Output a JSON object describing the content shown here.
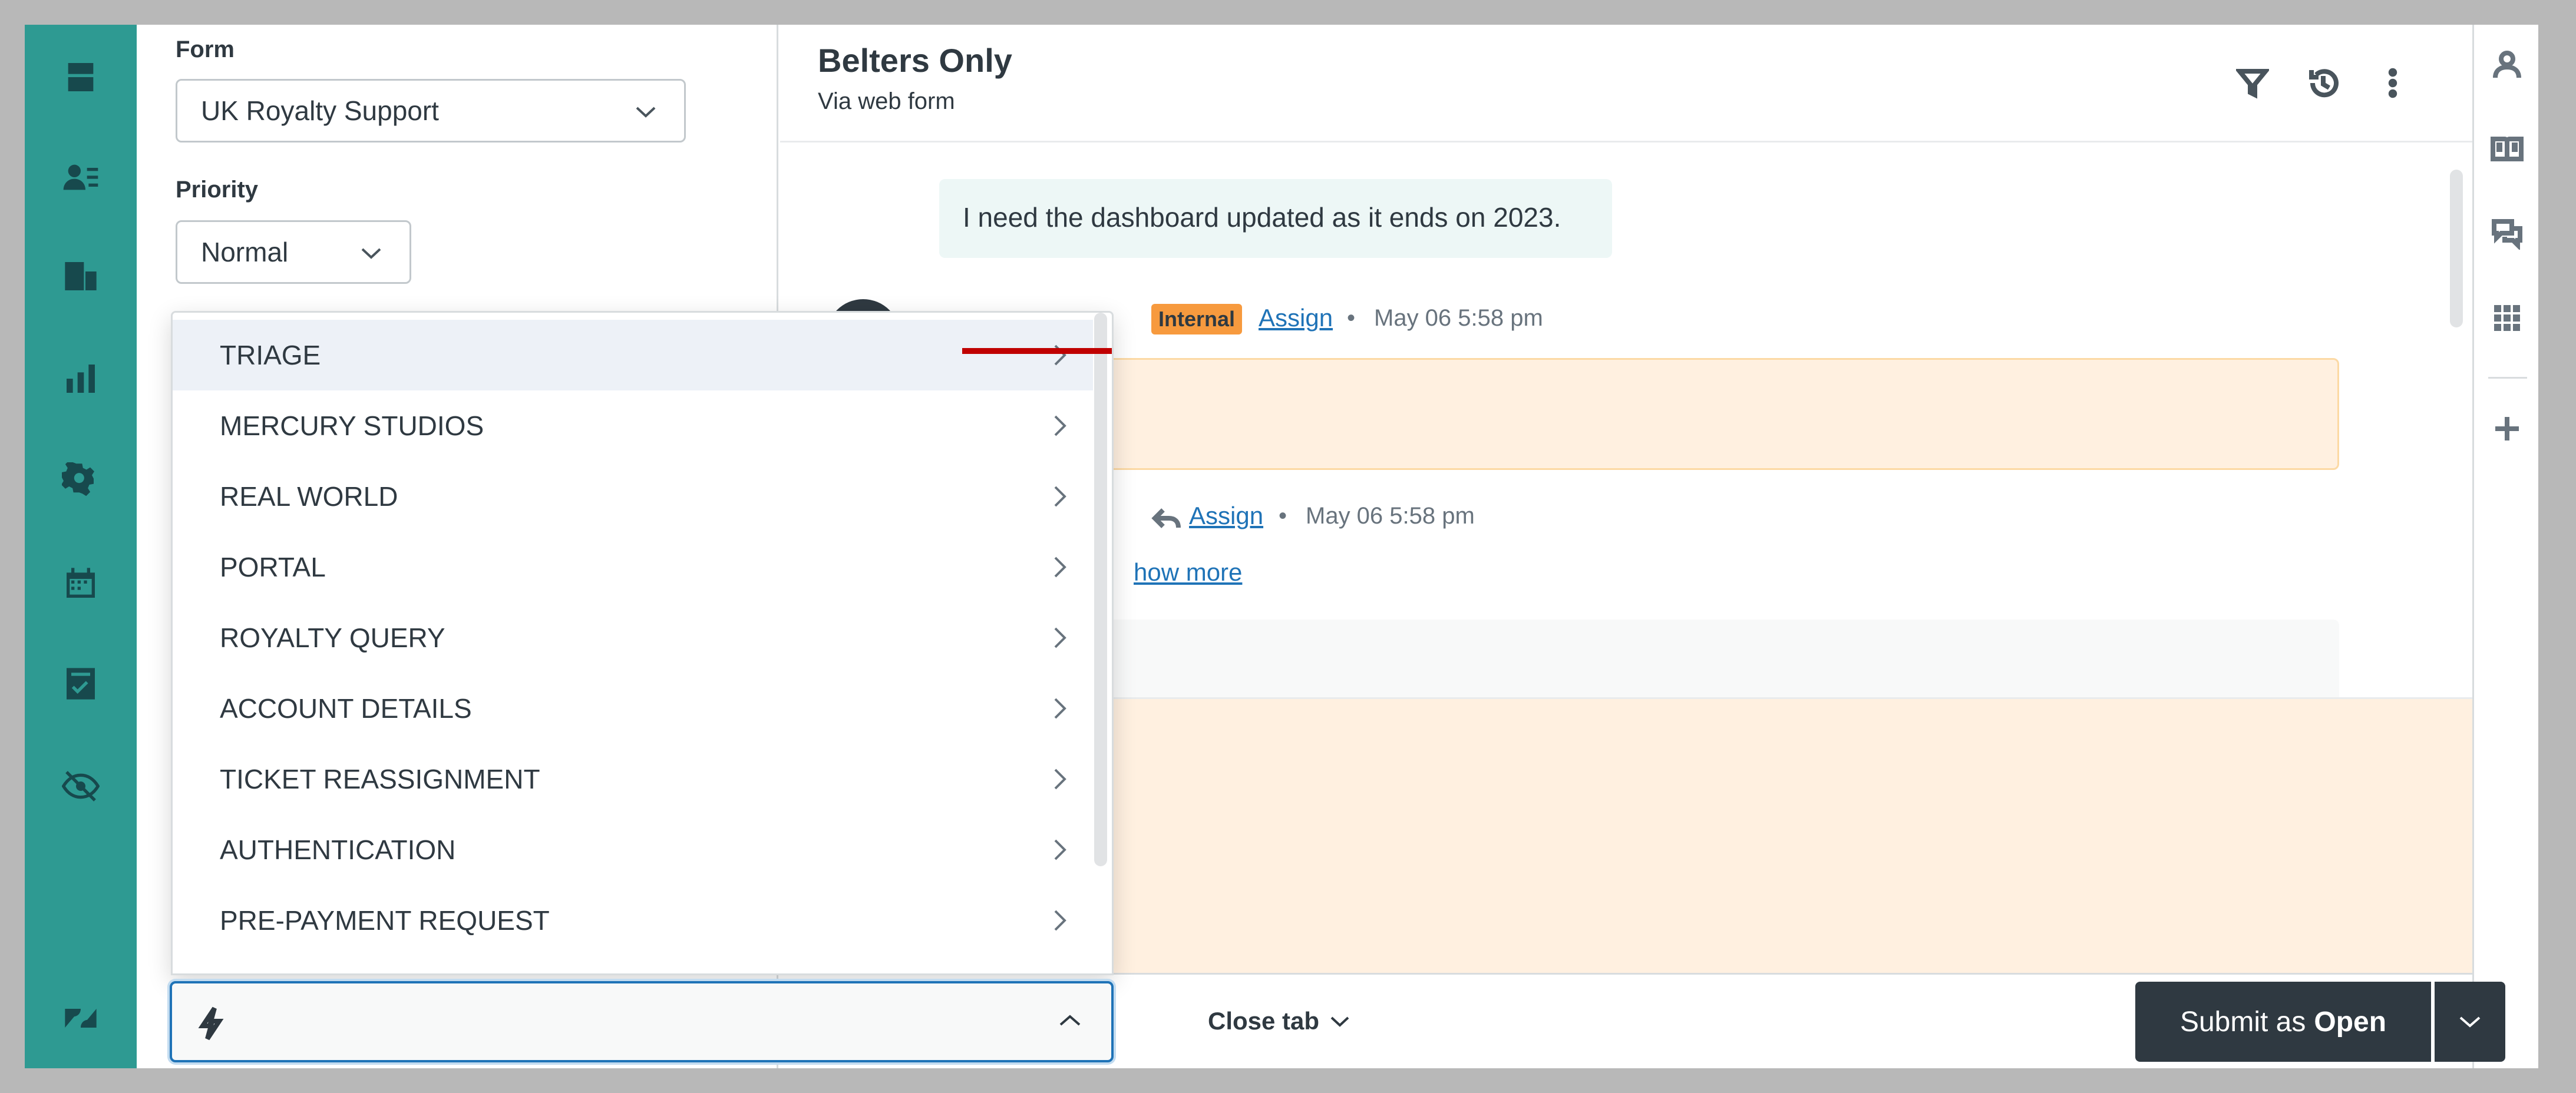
{
  "ticket": {
    "title": "Belters Only",
    "channel": "Via web form"
  },
  "properties": {
    "form_label": "Form",
    "form_value": "UK Royalty Support",
    "priority_label": "Priority",
    "priority_value": "Normal"
  },
  "conversation": {
    "bubble_text": "I need the dashboard updated as it ends on 2023.",
    "event1": {
      "badge": "Internal",
      "assign": "Assign",
      "sep": "•",
      "time": "May 06 5:58 pm"
    },
    "event2": {
      "assign": "Assign",
      "sep": "•",
      "time": "May 06 5:58 pm",
      "show_more": "how more"
    }
  },
  "menu": {
    "items": [
      {
        "label": "TRIAGE"
      },
      {
        "label": "MERCURY STUDIOS"
      },
      {
        "label": "REAL WORLD"
      },
      {
        "label": "PORTAL"
      },
      {
        "label": "ROYALTY QUERY"
      },
      {
        "label": "ACCOUNT DETAILS"
      },
      {
        "label": "TICKET REASSIGNMENT"
      },
      {
        "label": "AUTHENTICATION"
      },
      {
        "label": "PRE-PAYMENT REQUEST"
      }
    ]
  },
  "footer": {
    "close_tab": "Close tab",
    "submit_prefix": "Submit as",
    "submit_status": "Open"
  },
  "colors": {
    "nav": "#2e9a92",
    "accent": "#1f73b7",
    "internal_badge": "#f79a3e",
    "submit": "#2f3941",
    "annotation_arrow": "#c00000"
  },
  "icons": {
    "nav": [
      "inbox-icon",
      "customers-icon",
      "organizations-icon",
      "reporting-icon",
      "settings-icon",
      "calendar-icon",
      "checklist-icon",
      "hidden-eye-icon",
      "zendesk-logo-icon"
    ],
    "header": [
      "filter-icon",
      "history-icon",
      "more-options-icon"
    ],
    "right_sidebar": [
      "user-icon",
      "knowledge-book-icon",
      "conversations-icon",
      "apps-grid-icon",
      "add-icon"
    ]
  }
}
